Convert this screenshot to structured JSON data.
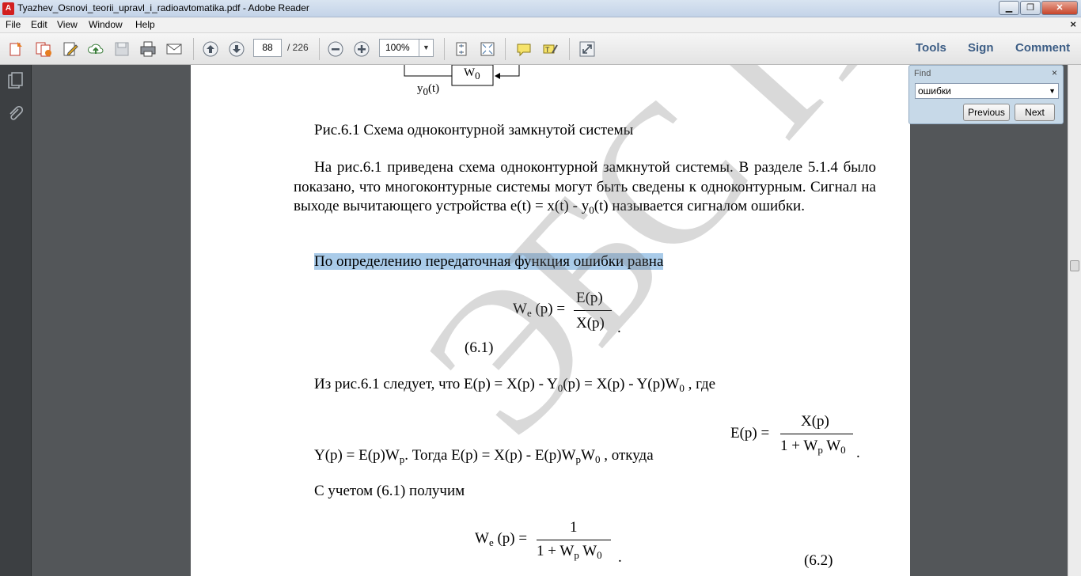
{
  "window": {
    "title": "Tyazhev_Osnovi_teorii_upravl_i_radioavtomatika.pdf - Adobe Reader",
    "app_icon": "adobe-reader-icon",
    "min_label": "▁",
    "max_label": "❐",
    "close_label": "✕"
  },
  "menu": {
    "items": [
      "File",
      "Edit",
      "View",
      "Window",
      "Help"
    ],
    "doc_close": "×"
  },
  "toolbar": {
    "page_current": "88",
    "page_total": "/ 226",
    "zoom": "100%",
    "tools_label": "Tools",
    "sign_label": "Sign",
    "comment_label": "Comment"
  },
  "find": {
    "title": "Find",
    "close": "×",
    "query": "ошибки",
    "previous_label": "Previous",
    "next_label": "Next"
  },
  "document": {
    "diagram_block": "W",
    "diagram_block_sub": "0",
    "diagram_output": "y",
    "diagram_output_sub": "0",
    "diagram_output_arg": "(t)",
    "figure_caption": "Рис.6.1 Схема одноконтурной замкнутой системы",
    "para1_a": "На рис.6.1 приведена схема одноконтурной замкнутой системы. В разделе 5.1.4 было показано, что многоконтурные системы могут быть сведены к одноконтурным. Сигнал на выходе вычитающего устройства  e(t) = x(t) - y",
    "para1_sub": "0",
    "para1_b": "(t) называется сигналом ошибки.",
    "highlight_sentence": "По определению передаточная функция ошибки равна",
    "eq1_lhs": "W",
    "eq1_lhs_sub": "e",
    "eq1_lhs_arg": " (p) =",
    "eq1_num": "E(p)",
    "eq1_den": "X(p)",
    "eq1_dot": ".",
    "eq1_label": "(6.1)",
    "line_from_a": "Из рис.6.1 следует, что  E(p) = X(p) - Y",
    "line_from_sub1": "0",
    "line_from_b": "(p) = X(p) - Y(p)W",
    "line_from_sub2": "0",
    "line_from_c": " ,  где",
    "line_y_a": "Y(p) = E(p)W",
    "line_y_sub1": "p",
    "line_y_b": ".  Тогда   E(p) = X(p) - E(p)W",
    "line_y_sub2": "p",
    "line_y_c": "W",
    "line_y_sub3": "0",
    "line_y_d": " ,   откуда",
    "eq2_lhs": "E(p) =",
    "eq2_num": "X(p)",
    "eq2_den_a": "1 + W",
    "eq2_den_sub1": "p",
    "eq2_den_b": " W",
    "eq2_den_sub2": "0",
    "eq2_dot": ".",
    "line_with": "С учетом (6.1) получим",
    "eq3_lhs": "W",
    "eq3_lhs_sub": "e",
    "eq3_lhs_arg": " (p) =",
    "eq3_num": "1",
    "eq3_den_a": "1 + W",
    "eq3_den_sub1": "p",
    "eq3_den_b": " W",
    "eq3_den_sub2": "0",
    "eq3_dot": ".",
    "eq3_label": "(6.2)",
    "watermark": "ЭБС ПГУТИ"
  }
}
